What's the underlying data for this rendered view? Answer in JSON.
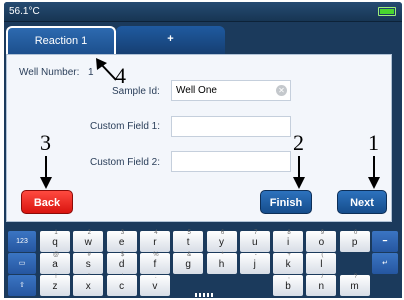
{
  "status": {
    "temperature": "56.1°C"
  },
  "tabs": [
    {
      "label": "Reaction 1"
    },
    {
      "label": "+"
    }
  ],
  "form": {
    "well_number_label": "Well Number:",
    "well_number_value": "1",
    "sample_id_label": "Sample Id:",
    "sample_id_value": "Well One",
    "custom_field_1_label": "Custom Field 1:",
    "custom_field_1_value": "",
    "custom_field_2_label": "Custom Field 2:",
    "custom_field_2_value": ""
  },
  "buttons": {
    "back": "Back",
    "finish": "Finish",
    "next": "Next"
  },
  "annotations": [
    "1",
    "2",
    "3",
    "4"
  ],
  "keyboard": {
    "row1_left": "123",
    "row1_keys": [
      {
        "letter": "q",
        "num": "1"
      },
      {
        "letter": "w",
        "num": "2"
      },
      {
        "letter": "e",
        "num": "3"
      },
      {
        "letter": "r",
        "num": "4"
      },
      {
        "letter": "t",
        "num": "5"
      },
      {
        "letter": "y",
        "num": "6"
      },
      {
        "letter": "u",
        "num": "7"
      },
      {
        "letter": "i",
        "num": "8"
      },
      {
        "letter": "o",
        "num": "9"
      },
      {
        "letter": "p",
        "num": "0"
      }
    ],
    "row2_keys": [
      {
        "letter": "a",
        "num": "@"
      },
      {
        "letter": "s",
        "num": "#"
      },
      {
        "letter": "d",
        "num": "$"
      },
      {
        "letter": "f",
        "num": "%"
      },
      {
        "letter": "g",
        "num": "&"
      },
      {
        "letter": "h",
        "num": "*"
      },
      {
        "letter": "j",
        "num": "-"
      },
      {
        "letter": "k",
        "num": "+"
      },
      {
        "letter": "l",
        "num": "("
      }
    ],
    "row3_keys": [
      {
        "letter": "z",
        "num": "!"
      },
      {
        "letter": "x",
        "num": "\""
      },
      {
        "letter": "c",
        "num": "'"
      },
      {
        "letter": "v",
        "num": ":"
      },
      {
        "letter": "b",
        "num": ";"
      },
      {
        "letter": "n",
        "num": "/"
      },
      {
        "letter": "m",
        "num": "?"
      }
    ],
    "backspace_icon": "backspace-icon",
    "enter_icon": "enter-icon",
    "shift_icon": "shift-icon",
    "settings_icon": "keyboard-settings-icon"
  },
  "colors": {
    "frame": "#1b3a5c",
    "back": "#e5231c",
    "primary": "#1f5fa8",
    "battery": "#48d62e"
  }
}
